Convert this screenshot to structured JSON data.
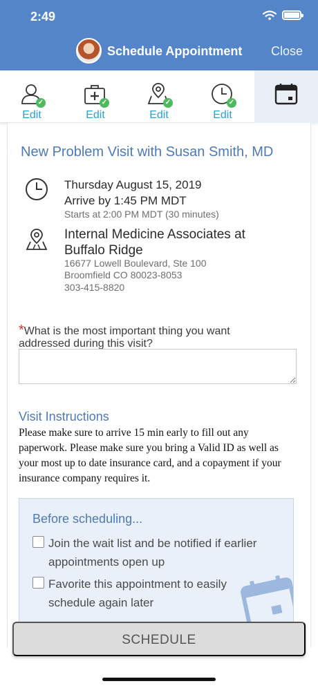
{
  "status_bar": {
    "time": "2:49"
  },
  "header": {
    "title": "Schedule Appointment",
    "close_label": "Close"
  },
  "steps": [
    {
      "icon": "person-icon",
      "label": "Edit",
      "done": true
    },
    {
      "icon": "medical-kit-icon",
      "label": "Edit",
      "done": true
    },
    {
      "icon": "map-pin-icon",
      "label": "Edit",
      "done": true
    },
    {
      "icon": "clock-icon",
      "label": "Edit",
      "done": true
    },
    {
      "icon": "calendar-icon",
      "label": "",
      "active": true
    }
  ],
  "visit": {
    "title": "New Problem Visit with Susan Smith, MD",
    "date": "Thursday August 15, 2019",
    "arrive": "Arrive by 1:45 PM MDT",
    "starts": "Starts at 2:00 PM MDT (30 minutes)",
    "location_name": "Internal Medicine Associates at Buffalo Ridge",
    "address_line1": "16677 Lowell Boulevard, Ste 100",
    "address_line2": "Broomfield CO 80023-8053",
    "phone": "303-415-8820"
  },
  "question": {
    "required_mark": "*",
    "text": "What is the most important thing you want addressed during this visit?",
    "value": ""
  },
  "instructions": {
    "title": "Visit Instructions",
    "text": "Please make sure to arrive 15 min early to fill out any paperwork. Please make sure you bring a Valid ID as well as your most up to date insurance card, and a copayment if your insurance company requires it."
  },
  "before_scheduling": {
    "title": "Before scheduling...",
    "options": [
      {
        "label": "Join the wait list and be notified if earlier appointments open up",
        "checked": false
      },
      {
        "label": "Favorite this appointment to easily schedule again later",
        "checked": false
      }
    ]
  },
  "schedule_button": {
    "label": "SCHEDULE"
  },
  "colors": {
    "header": "#5585c9",
    "accent": "#4d79b6",
    "link": "#2a9fd6",
    "check": "#4cba5d",
    "required": "#d0342c"
  }
}
